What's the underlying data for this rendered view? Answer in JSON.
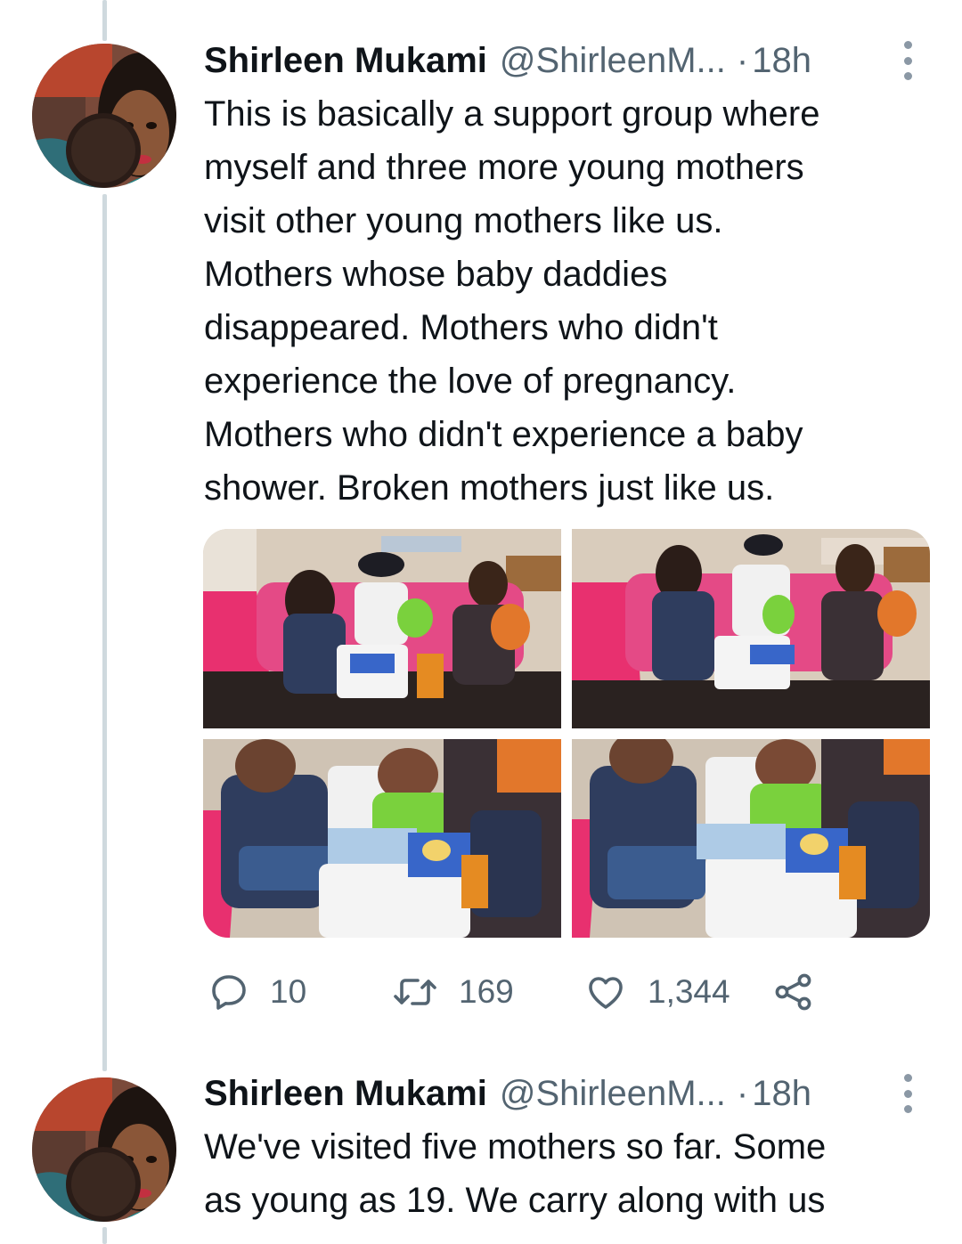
{
  "tweets": [
    {
      "author": {
        "name": "Shirleen Mukami",
        "handle": "@ShirleenM...",
        "time": "18h"
      },
      "text": "This is basically a support group where\nmyself and three more young mothers\nvisit other young mothers like us.\nMothers whose baby daddies\ndisappeared. Mothers who didn't\nexperience the love of pregnancy.\nMothers who didn't experience a baby\nshower. Broken mothers just like us.",
      "media_count": 4,
      "stats": {
        "replies": "10",
        "retweets": "169",
        "likes": "1,344"
      }
    },
    {
      "author": {
        "name": "Shirleen Mukami",
        "handle": "@ShirleenM...",
        "time": "18h"
      },
      "text": "We've visited five mothers so far. Some\nas young as 19. We carry along with us"
    }
  ],
  "separator": "·",
  "icons": {
    "more": "more-vertical-icon",
    "reply": "reply-icon",
    "retweet": "retweet-icon",
    "like": "heart-icon",
    "share": "share-icon"
  },
  "colors": {
    "text": "#0f1419",
    "secondary": "#536471",
    "thread_line": "#cfd9de",
    "sofa_pink": "#e8306f",
    "wall": "#d9ccbc"
  }
}
